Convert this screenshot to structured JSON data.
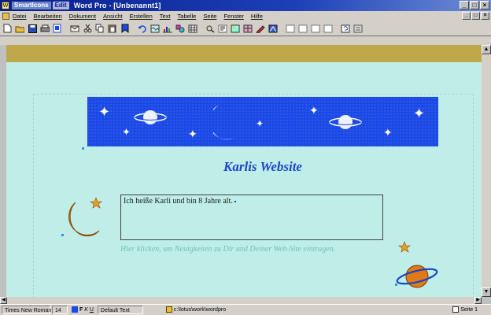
{
  "window": {
    "smarticon_tabs": [
      "SmartIcons",
      "Edit"
    ],
    "title": "Word Pro - [Unbenannt1]",
    "buttons": {
      "minimize": "_",
      "maximize": "□",
      "close": "×"
    }
  },
  "menu": {
    "items": [
      "Datei",
      "Bearbeiten",
      "Dokument",
      "Ansicht",
      "Erstellen",
      "Text",
      "Tabelle",
      "Seite",
      "Fenster",
      "Hilfe"
    ]
  },
  "toolbar": {
    "icons": [
      "new-document-icon",
      "open-icon",
      "save-icon",
      "print-icon",
      "preview-icon",
      "email-icon",
      "cut-icon",
      "copy-icon",
      "paste-icon",
      "bookmark-icon",
      "undo-icon",
      "insert-frame-icon",
      "insert-chart-icon",
      "insert-drawing-icon",
      "insert-table-icon",
      "spellcheck-icon",
      "format-icon",
      "insert-image-icon",
      "grid-icon",
      "draw-icon",
      "clip-icon",
      "frame-a-icon",
      "frame-b-icon",
      "frame-c-icon",
      "frame-d-icon",
      "help-icon",
      "more-icon"
    ]
  },
  "document": {
    "heading": "Karlis Website",
    "box_text": "Ich heiße Karli und bin 8 Jahre alt.",
    "hint_text": "Hier klicken, um Neuigkeiten zu Dir und Deiner Web-Site eintragen.",
    "colors": {
      "banner": "#1b49e6",
      "heading": "#1d44c8",
      "hint": "#6ec0b5",
      "background": "#bfeee8",
      "ruler_band": "#bfa84a"
    }
  },
  "statusbar": {
    "font": "Times New Roman",
    "size": "14",
    "style": "Default Text",
    "path": "c:\\lotus\\work\\wordpro",
    "page": "Seite 1"
  }
}
